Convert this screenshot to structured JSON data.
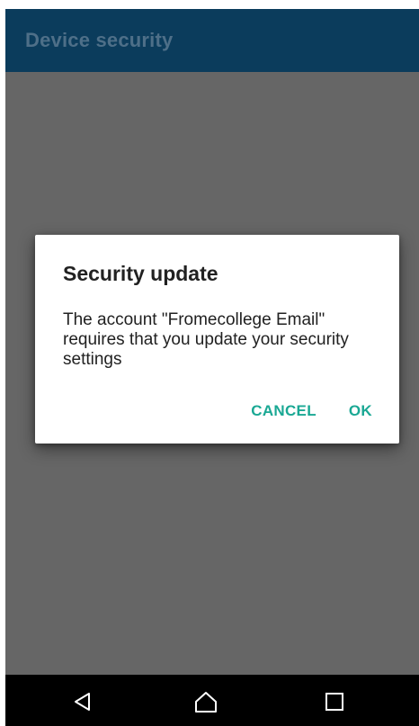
{
  "app_bar": {
    "title": "Device security",
    "background": "#0b3c5c",
    "title_color": "#4e6f88"
  },
  "dialog": {
    "title": "Security update",
    "message": "The account \"Fromecollege Email\" requires that you update your security settings",
    "cancel_label": "CANCEL",
    "ok_label": "OK",
    "accent_color": "#1aa894"
  },
  "nav_bar": {
    "back_icon": "back-triangle-icon",
    "home_icon": "home-icon",
    "recent_icon": "recent-apps-icon"
  },
  "colors": {
    "scrim": "#666666",
    "nav_background": "#000000"
  }
}
